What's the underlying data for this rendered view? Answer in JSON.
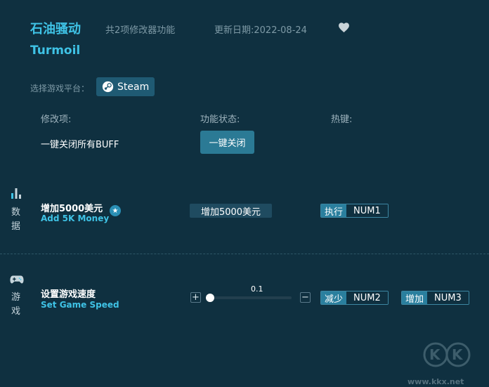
{
  "header": {
    "title_cn": "石油骚动",
    "title_en": "Turmoil",
    "feature_count": "共2项修改器功能",
    "update_date": "更新日期:2022-08-24"
  },
  "platform": {
    "label": "选择游戏平台：",
    "steam_label": "Steam"
  },
  "table_headers": {
    "mod": "修改项:",
    "status": "功能状态:",
    "hotkey": "热键:"
  },
  "global_toggle": {
    "label": "一键关闭所有BUFF",
    "button": "一键关闭"
  },
  "sections": {
    "data": {
      "char1": "数",
      "char2": "据"
    },
    "game": {
      "char1": "游",
      "char2": "戏"
    }
  },
  "mods": {
    "money": {
      "name_cn": "增加5000美元",
      "name_en": "Add 5K Money",
      "action": "增加5000美元",
      "hotkey_label": "执行",
      "hotkey_key": "NUM1"
    },
    "speed": {
      "name_cn": "设置游戏速度",
      "name_en": "Set Game Speed",
      "value": "0.1",
      "plus": "+",
      "minus": "−",
      "dec_label": "减少",
      "dec_key": "NUM2",
      "inc_label": "增加",
      "inc_key": "NUM3"
    }
  },
  "watermark": {
    "url": "www.kkx.net"
  },
  "icons": {
    "heart": "heart-icon",
    "steam": "steam-icon",
    "bar_chart": "bar-chart-icon",
    "gamepad": "gamepad-icon",
    "star": "star-icon"
  },
  "colors": {
    "background": "#0f3040",
    "accent": "#3fc3e6",
    "button": "#2b7a95",
    "hotkey_label": "#2a7f9e"
  }
}
